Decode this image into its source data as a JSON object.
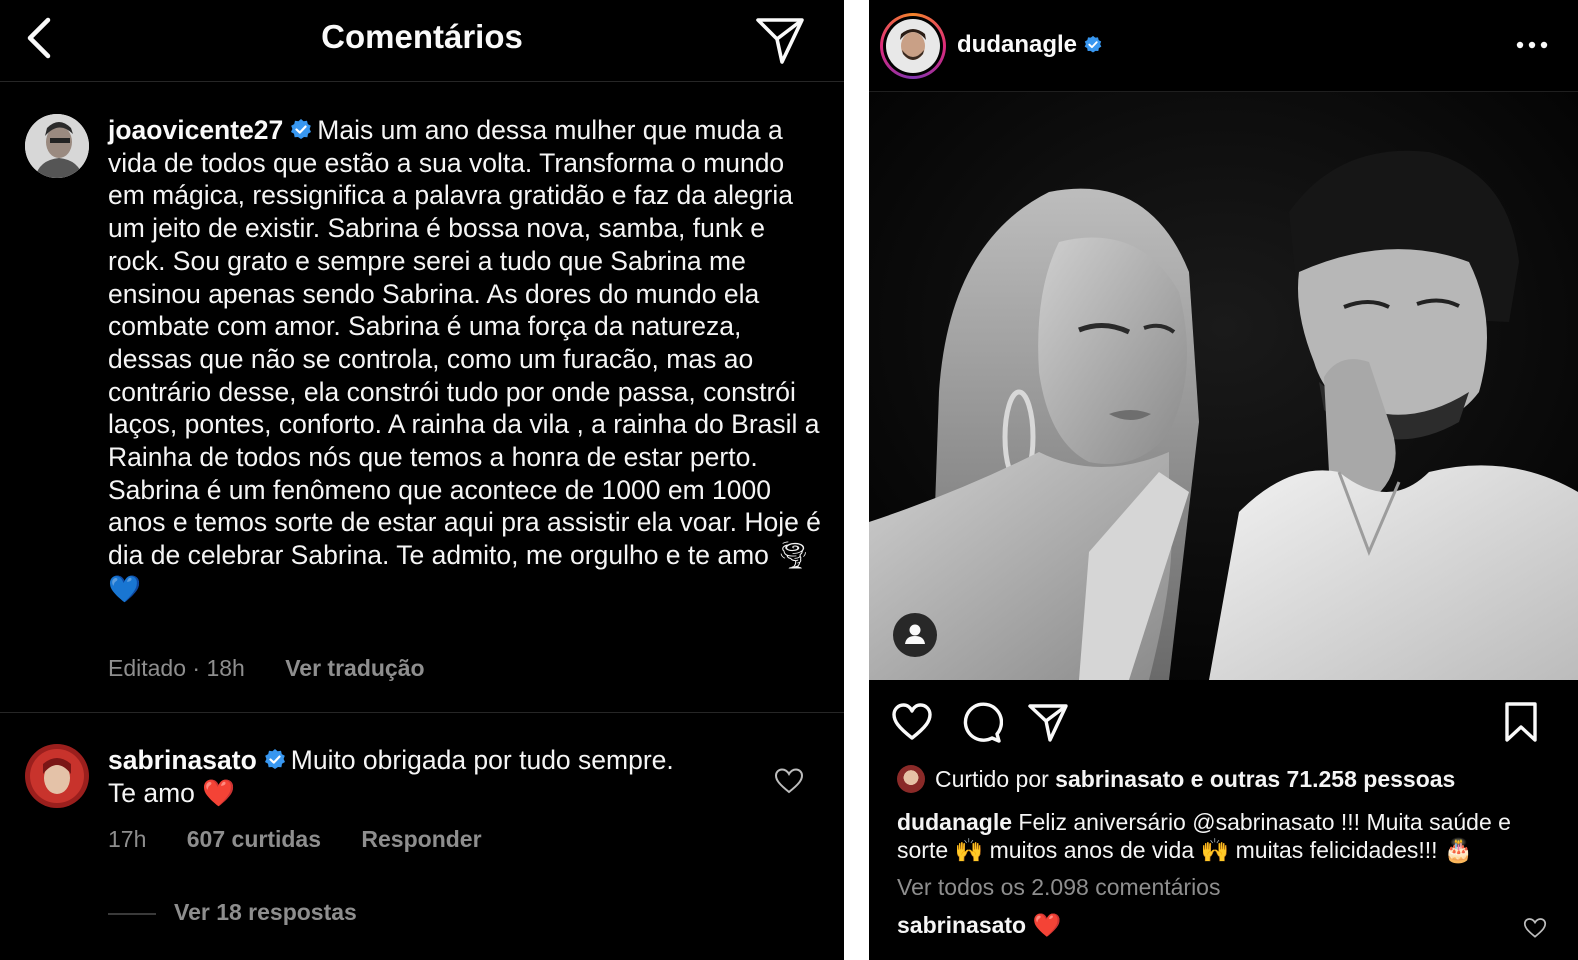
{
  "comments_screen": {
    "title": "Comentários",
    "comments": [
      {
        "username": "joaovicente27",
        "verified": true,
        "text": "Mais um ano dessa mulher que muda a vida de todos que estão a sua volta. Transforma o mundo em mágica, ressignifica a palavra gratidão e faz da alegria um jeito de existir. Sabrina é bossa nova, samba, funk e rock. Sou grato e sempre serei a tudo que Sabrina me ensinou apenas sendo Sabrina. As dores do mundo ela combate com amor. Sabrina é uma força da natureza, dessas que não se controla, como um furacão, mas ao contrário desse, ela constrói tudo por onde passa, constrói laços, pontes, conforto. A rainha da vila , a rainha do Brasil a Rainha de todos nós que temos a honra de estar perto. Sabrina é um fenômeno que acontece de 1000 em 1000 anos e temos sorte de estar aqui pra assistir ela voar. Hoje é dia de celebrar Sabrina. Te admito, me orgulho e te amo",
        "emojis": "🌪💙",
        "time": "Editado · 18h",
        "translate": "Ver tradução"
      },
      {
        "username": "sabrinasato",
        "verified": true,
        "text": "Muito obrigada por tudo sempre. Te amo",
        "emojis": "❤️",
        "time": "17h",
        "likes": "607 curtidas",
        "reply": "Responder",
        "view_replies": "Ver 18 respostas"
      }
    ]
  },
  "post": {
    "username": "dudanagle",
    "verified": true,
    "liked_by_prefix": "Curtido por",
    "liked_by_user": "sabrinasato",
    "liked_by_and": "e",
    "liked_by_others": "outras 71.258 pessoas",
    "caption_user": "dudanagle",
    "caption_part1": "Feliz aniversário @sabrinasato !!! Muita saúde e sorte",
    "caption_emoji1": "🙌",
    "caption_part2": "muitos anos de vida",
    "caption_emoji2": "🙌",
    "caption_part3": "muitas felicidades!!!",
    "caption_emoji3": "🎂",
    "view_all_comments": "Ver todos os 2.098 comentários",
    "top_comment_user": "sabrinasato",
    "top_comment_emoji": "❤️"
  },
  "colors": {
    "background": "#000000",
    "text_primary": "#f5f5f5",
    "text_secondary": "#8e8e8e",
    "verified_blue": "#3897f0",
    "divider": "#262626",
    "heart_red": "#e8323c"
  },
  "icons": [
    "back-arrow-icon",
    "direct-message-icon",
    "verified-badge-icon",
    "heart-outline-icon",
    "comment-bubble-icon",
    "share-icon",
    "bookmark-icon",
    "more-options-icon",
    "user-tag-icon"
  ]
}
